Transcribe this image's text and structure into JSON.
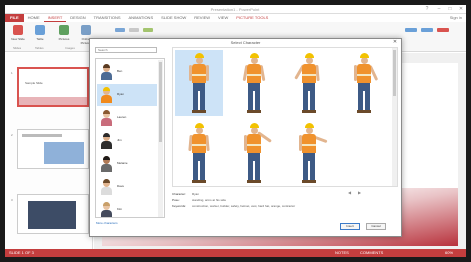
{
  "app": {
    "title": "Presentation1 - PowerPoint",
    "file_tab": "FILE",
    "tabs": [
      "HOME",
      "INSERT",
      "DESIGN",
      "TRANSITIONS",
      "ANIMATIONS",
      "SLIDE SHOW",
      "REVIEW",
      "VIEW",
      "DEVELOPER"
    ],
    "selected_tab": "INSERT",
    "contextual_tab": "PICTURE TOOLS",
    "sign_in": "Sign in",
    "ribbon_buttons": [
      "New Slide",
      "Table",
      "Pictures",
      "Online Pictures"
    ],
    "ribbon_groups": [
      "Slides",
      "Tables",
      "Images"
    ]
  },
  "thumbnails": [
    {
      "number": "1",
      "caption": "Sample Slide"
    },
    {
      "number": "2",
      "caption": ""
    },
    {
      "number": "3",
      "caption": ""
    }
  ],
  "dialog": {
    "title": "Select Character",
    "close_glyph": "✕",
    "search_placeholder": "Search",
    "people": [
      {
        "name": "Ben",
        "skin": "#dcae8a",
        "hair": "#5a3b22",
        "shirt": "#4d6b94"
      },
      {
        "name": "Ryan",
        "skin": "#e2b58f",
        "hair": "#f2c200",
        "shirt": "#f08a1c"
      },
      {
        "name": "Lauren",
        "skin": "#e8c4a4",
        "hair": "#8a5a32",
        "shirt": "#c96c7b"
      },
      {
        "name": "Jim",
        "skin": "#dcae8a",
        "hair": "#2b2b2b",
        "shirt": "#2d2d2d"
      },
      {
        "name": "Melanie",
        "skin": "#b07a56",
        "hair": "#1f1a17",
        "shirt": "#6a6a6a"
      },
      {
        "name": "Dave",
        "skin": "#e2b58f",
        "hair": "#6b4a2a",
        "shirt": "#dcdcdc"
      },
      {
        "name": "Kim",
        "skin": "#e8c4a4",
        "hair": "#c9a06a",
        "shirt": "#444a5c"
      }
    ],
    "selected_person": "Ryan",
    "more_link": "More characters",
    "pose_count": "7",
    "nav": {
      "prev": "◀",
      "next": "▶"
    },
    "details": {
      "character_label": "Character:",
      "character_value": "Ryan",
      "pose_label": "Pose:",
      "pose_value": "standing, arms at his side",
      "keywords_label": "Keywords:",
      "keywords_value": "construction, worker, builder, safety, helmet, vest, hard hat, orange, contractor"
    },
    "buttons": {
      "insert": "Insert",
      "cancel": "Cancel"
    }
  },
  "status": {
    "text": "SLIDE 1 OF 3",
    "notes": "NOTES",
    "comments": "COMMENTS",
    "zoom": "60%"
  },
  "colors": {
    "accent": "#c43e3e",
    "selection": "#cde3f7",
    "vest": "#f08a1c",
    "helmet": "#f2c200",
    "jeans": "#3d5a85"
  }
}
